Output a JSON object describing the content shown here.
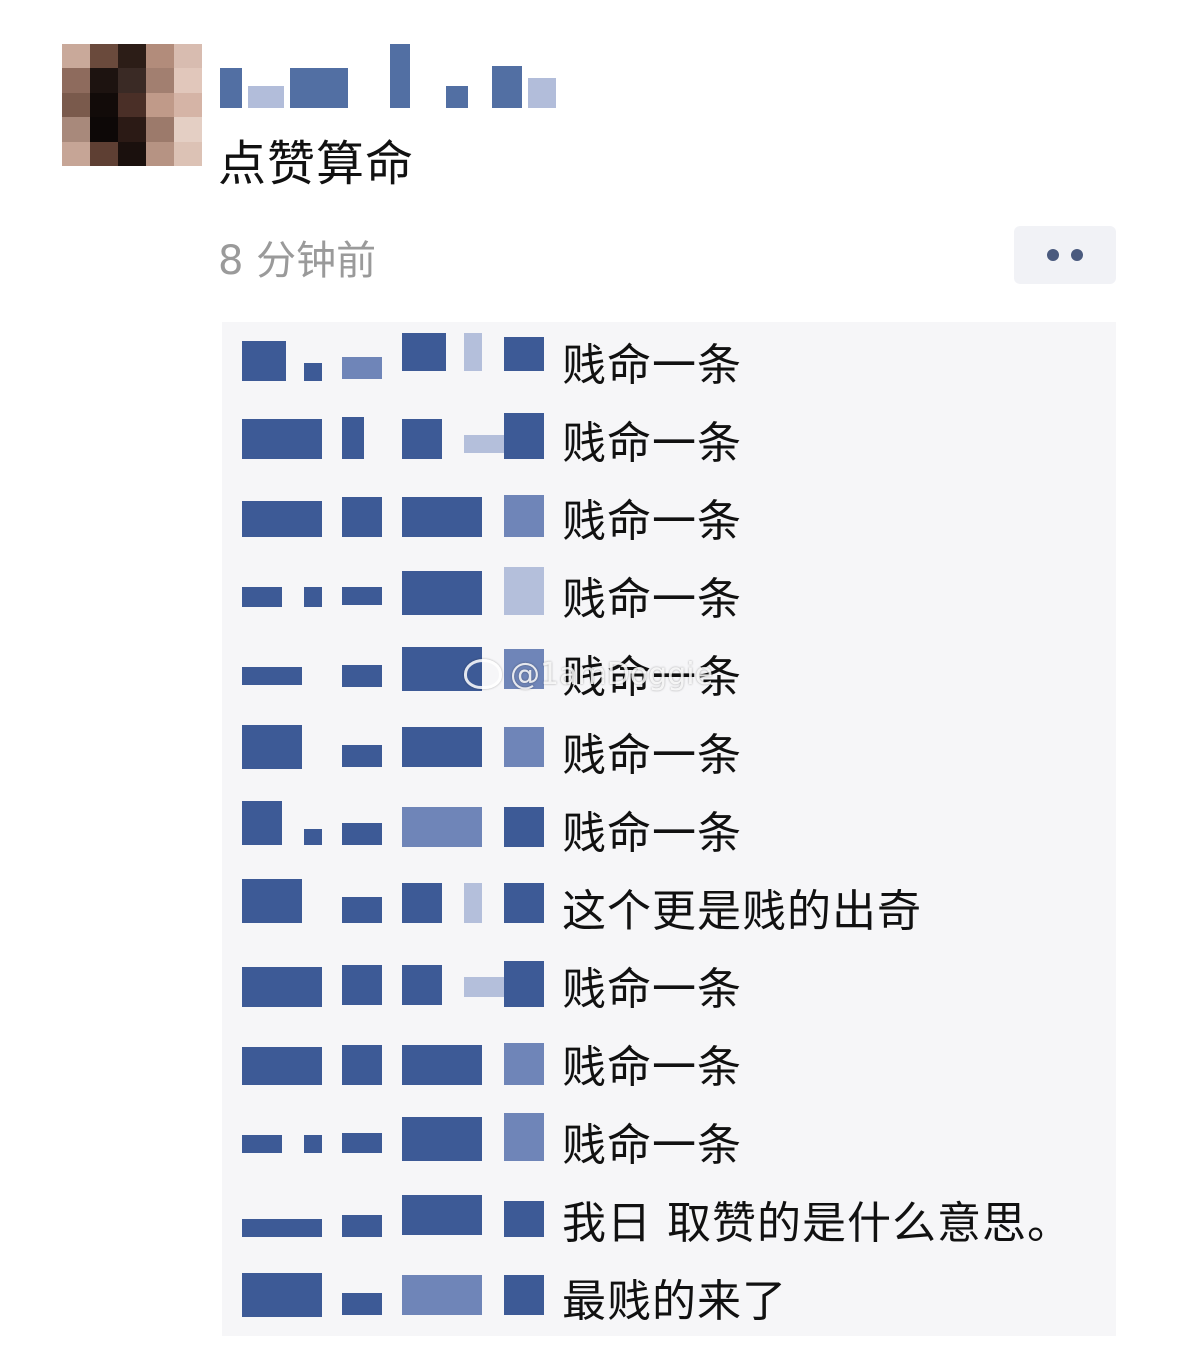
{
  "post": {
    "text": "点赞算命",
    "time": "8 分钟前"
  },
  "watermark": {
    "icon": "weibo-icon",
    "text": "@1amDoggie"
  },
  "comments": [
    {
      "text": "贱命一条"
    },
    {
      "text": "贱命一条"
    },
    {
      "text": "贱命一条"
    },
    {
      "text": "贱命一条"
    },
    {
      "text": "贱命一条"
    },
    {
      "text": "贱命一条"
    },
    {
      "text": "贱命一条"
    },
    {
      "text": "这个更是贱的出奇"
    },
    {
      "text": "贱命一条"
    },
    {
      "text": "贱命一条"
    },
    {
      "text": "贱命一条"
    },
    {
      "text": "我日 取赞的是什么意思。"
    },
    {
      "text": "最贱的来了"
    }
  ],
  "colors": {
    "blur_dark": "#3d5a96",
    "blur_light": "#b4bfdb",
    "comment_bg": "#f6f6f8",
    "time_gray": "#9a9a9a"
  }
}
